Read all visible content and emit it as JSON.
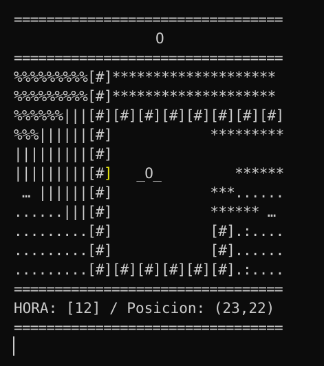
{
  "separator": "=================================",
  "top_marker": "O",
  "map_rows": [
    [
      "%%%%%%%%%[#]********************"
    ],
    [
      "%%%%%%%%%[#]********************"
    ],
    [
      "%%%%%%|||[#][#][#][#][#][#][#][#]"
    ],
    [
      "%%%||||||[#]            *********"
    ],
    [
      "|||||||||[#]"
    ],
    [
      "|||||||||[#",
      "]",
      "   _O_         ******"
    ],
    [
      " … ||||||[#]            ***......"
    ],
    [
      "......|||[#]            ****** …"
    ],
    [
      ".........[#]            [#].:...."
    ],
    [
      ".........[#]            [#]......"
    ],
    [
      ".........[#][#][#][#][#][#].:...."
    ]
  ],
  "status": {
    "text": "HORA: [12] / Posicion: (23,22)",
    "hour": 12,
    "position": "(23,22)"
  },
  "colors": {
    "background": "#0c0c0c",
    "text": "#cccccc",
    "highlight": "#e5e510"
  }
}
